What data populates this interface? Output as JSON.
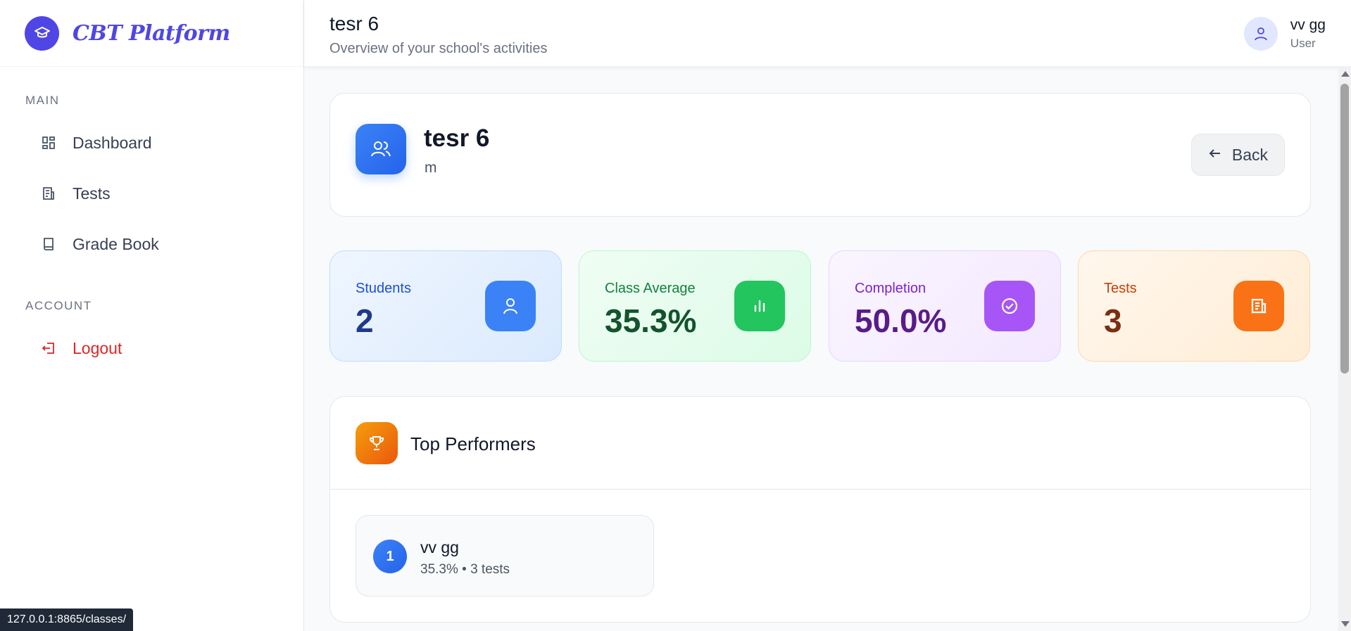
{
  "brand": {
    "name": "CBT Platform",
    "icon": "graduation-cap-icon"
  },
  "sidebar": {
    "sections": [
      {
        "label": "MAIN"
      },
      {
        "label": "ACCOUNT"
      }
    ],
    "items": [
      {
        "label": "Dashboard",
        "icon": "grid-icon"
      },
      {
        "label": "Tests",
        "icon": "document-icon"
      },
      {
        "label": "Grade Book",
        "icon": "book-icon"
      },
      {
        "label": "Logout",
        "icon": "logout-icon"
      }
    ]
  },
  "header": {
    "title": "tesr 6",
    "subtitle": "Overview of your school's activities",
    "user": {
      "name": "vv gg",
      "role": "User"
    }
  },
  "class_card": {
    "title": "tesr 6",
    "subtitle": "m",
    "back_label": "Back"
  },
  "stats": [
    {
      "label": "Students",
      "value": "2",
      "icon": "user-icon",
      "color": "#3b82f6"
    },
    {
      "label": "Class Average",
      "value": "35.3%",
      "icon": "bar-chart-icon",
      "color": "#22c55e"
    },
    {
      "label": "Completion",
      "value": "50.0%",
      "icon": "check-circle-icon",
      "color": "#a855f7"
    },
    {
      "label": "Tests",
      "value": "3",
      "icon": "document-icon",
      "color": "#f97316"
    }
  ],
  "top_performers": {
    "title": "Top Performers",
    "items": [
      {
        "rank": "1",
        "name": "vv gg",
        "meta": "35.3% • 3 tests"
      }
    ]
  },
  "statusbar": {
    "url": "127.0.0.1:8865/classes/"
  },
  "colors": {
    "accent": "#4f46e5",
    "danger": "#dc2626"
  }
}
